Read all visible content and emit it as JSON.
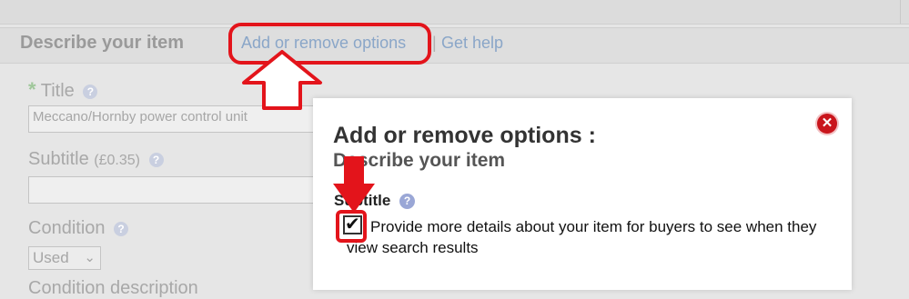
{
  "section": {
    "title": "Describe your item",
    "links": {
      "add_remove": "Add or remove options",
      "separator": "|",
      "get_help": "Get help"
    }
  },
  "form": {
    "title_label": "Title",
    "required_marker": "*",
    "title_value": "Meccano/Hornby power control unit",
    "subtitle_label": "Subtitle",
    "subtitle_price": "(£0.35)",
    "subtitle_value": "",
    "condition_label": "Condition",
    "condition_selected": "Used",
    "condition_description_label": "Condition description",
    "help_glyph": "?"
  },
  "modal": {
    "title": "Add or remove options :",
    "subtitle": "Describe your item",
    "close_glyph": "✕",
    "option": {
      "label": "Subtitle",
      "checked": true,
      "description": "Provide more details about your item for buyers to see when they view search results"
    }
  },
  "colors": {
    "annotation_red": "#e3141b",
    "close_red": "#c9151c",
    "link_blue": "#8aa6c8"
  },
  "icons": {
    "help": "question-circle-icon",
    "close": "close-circle-icon",
    "dropdown": "chevron-down-icon",
    "check": "check-icon"
  }
}
